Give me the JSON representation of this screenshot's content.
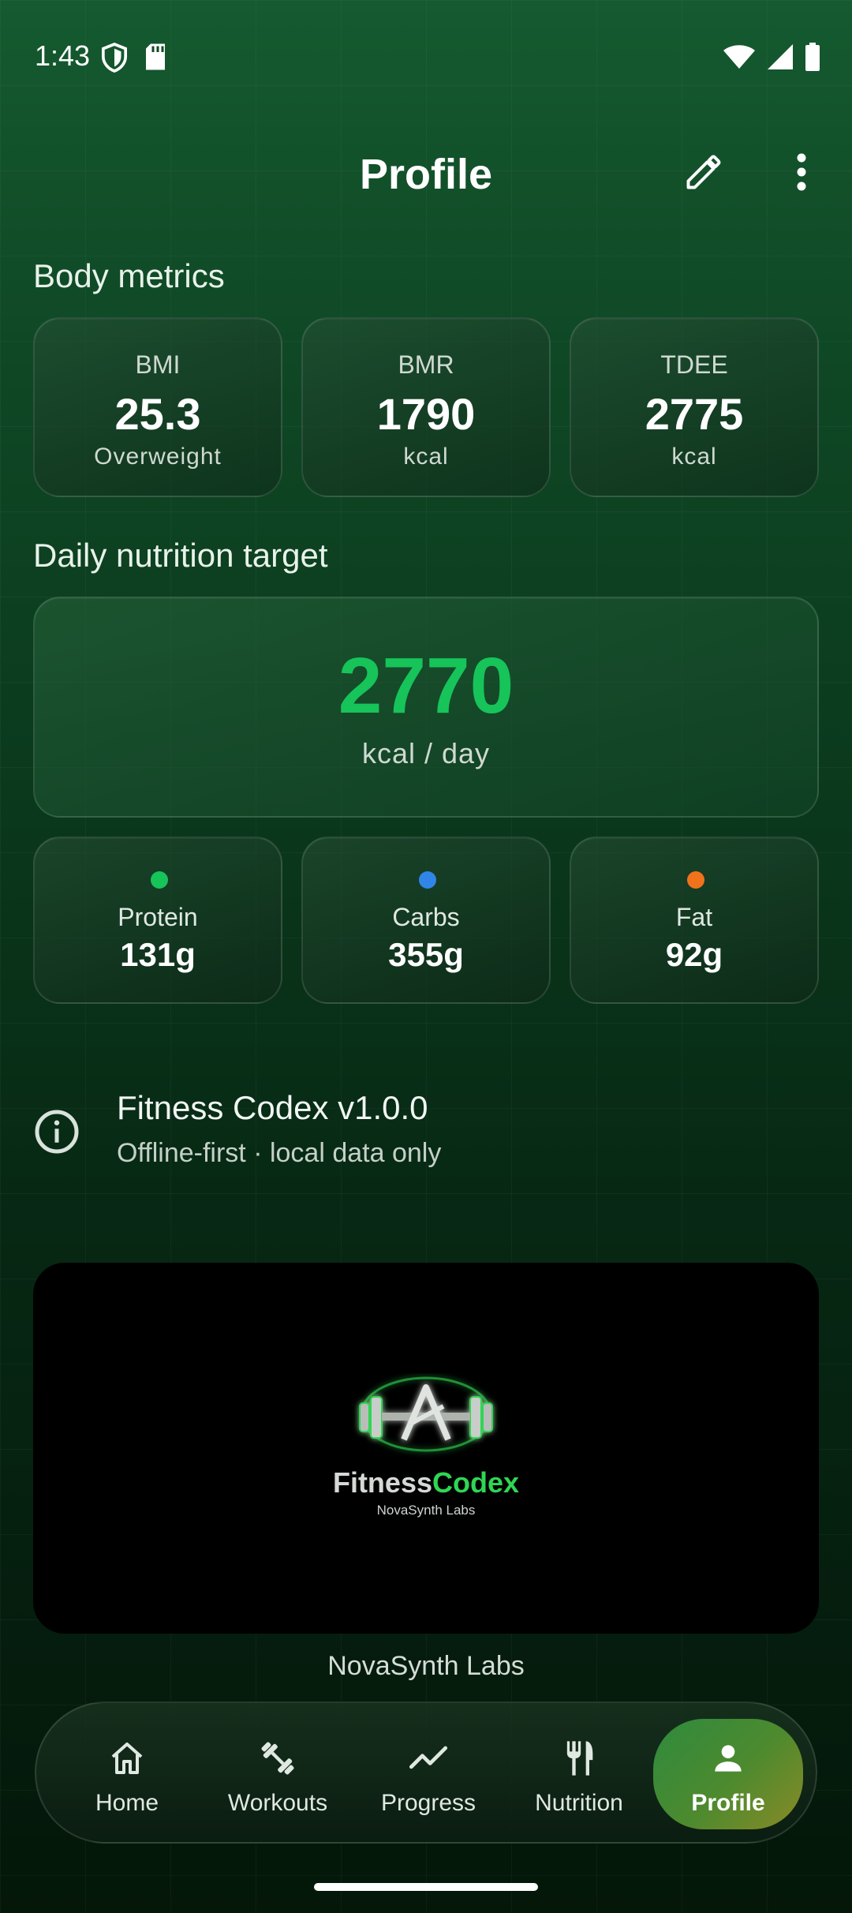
{
  "status_bar": {
    "time": "1:43",
    "left_icons": [
      "shield-icon",
      "sd-card-icon"
    ],
    "right_icons": [
      "wifi-icon",
      "signal-icon",
      "battery-icon"
    ]
  },
  "app_bar": {
    "title": "Profile",
    "actions": [
      "edit-icon",
      "more-vert-icon"
    ]
  },
  "body_metrics": {
    "title": "Body metrics",
    "cards": [
      {
        "label": "BMI",
        "value": "25.3",
        "unit": "Overweight"
      },
      {
        "label": "BMR",
        "value": "1790",
        "unit": "kcal"
      },
      {
        "label": "TDEE",
        "value": "2775",
        "unit": "kcal"
      }
    ]
  },
  "nutrition": {
    "title": "Daily nutrition target",
    "target_value": "2770",
    "target_unit": "kcal / day",
    "macros": [
      {
        "label": "Protein",
        "value": "131g",
        "color": "#16c45a"
      },
      {
        "label": "Carbs",
        "value": "355g",
        "color": "#2f86e6"
      },
      {
        "label": "Fat",
        "value": "92g",
        "color": "#f0731c"
      }
    ]
  },
  "app_info": {
    "icon": "info-icon",
    "title": "Fitness Codex v1.0.0",
    "subtitle": "Offline-first · local data only"
  },
  "logo": {
    "word_a": "Fitness",
    "word_b": "Codex",
    "sub": "NovaSynth Labs",
    "caption": "NovaSynth Labs"
  },
  "bottom_nav": {
    "items": [
      {
        "label": "Home",
        "icon": "home-icon"
      },
      {
        "label": "Workouts",
        "icon": "dumbbell-icon"
      },
      {
        "label": "Progress",
        "icon": "trend-icon"
      },
      {
        "label": "Nutrition",
        "icon": "utensils-icon"
      },
      {
        "label": "Profile",
        "icon": "person-icon",
        "active": true
      }
    ]
  },
  "colors": {
    "accent_green": "#16c45a",
    "active_nav_start": "#2e8b3e",
    "active_nav_end": "#8a8a26"
  }
}
